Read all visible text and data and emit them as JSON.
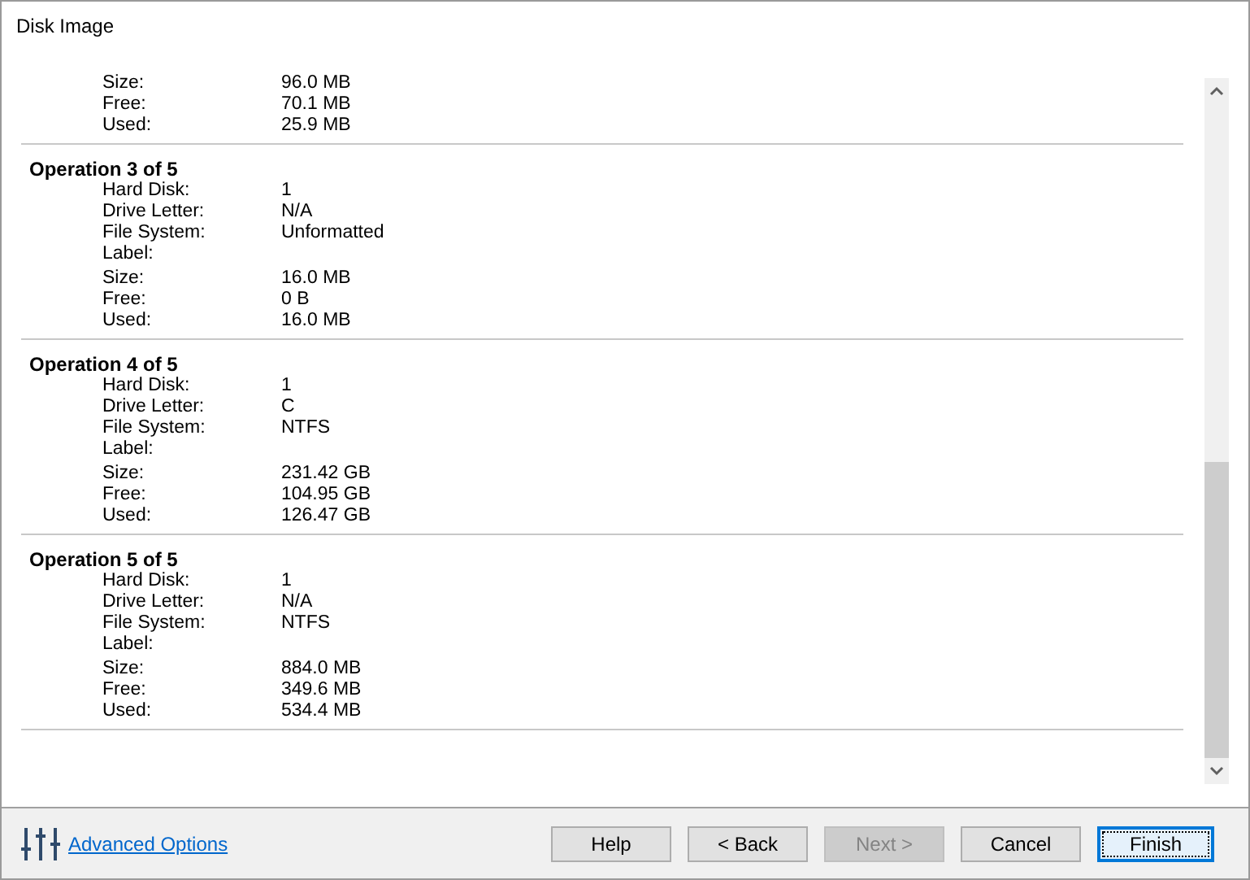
{
  "window": {
    "title": "Disk Image"
  },
  "sections": [
    {
      "groups": [
        [
          {
            "label": "Size:",
            "value": "96.0 MB"
          },
          {
            "label": "Free:",
            "value": "70.1 MB"
          },
          {
            "label": "Used:",
            "value": "25.9 MB"
          }
        ]
      ]
    },
    {
      "heading": "Operation 3 of 5",
      "groups": [
        [
          {
            "label": "Hard Disk:",
            "value": "1"
          },
          {
            "label": "Drive Letter:",
            "value": "N/A"
          },
          {
            "label": "File System:",
            "value": "Unformatted"
          },
          {
            "label": "Label:"
          }
        ],
        [
          {
            "label": "Size:",
            "value": "16.0 MB"
          },
          {
            "label": "Free:",
            "value": "0 B"
          },
          {
            "label": "Used:",
            "value": "16.0 MB"
          }
        ]
      ]
    },
    {
      "heading": "Operation 4 of 5",
      "groups": [
        [
          {
            "label": "Hard Disk:",
            "value": "1"
          },
          {
            "label": "Drive Letter:",
            "value": "C"
          },
          {
            "label": "File System:",
            "value": "NTFS"
          },
          {
            "label": "Label:"
          }
        ],
        [
          {
            "label": "Size:",
            "value": "231.42 GB"
          },
          {
            "label": "Free:",
            "value": "104.95 GB"
          },
          {
            "label": "Used:",
            "value": "126.47 GB"
          }
        ]
      ]
    },
    {
      "heading": "Operation 5 of 5",
      "groups": [
        [
          {
            "label": "Hard Disk:",
            "value": "1"
          },
          {
            "label": "Drive Letter:",
            "value": "N/A"
          },
          {
            "label": "File System:",
            "value": "NTFS"
          },
          {
            "label": "Label:"
          }
        ],
        [
          {
            "label": "Size:",
            "value": "884.0 MB"
          },
          {
            "label": "Free:",
            "value": "349.6 MB"
          },
          {
            "label": "Used:",
            "value": "534.4 MB"
          }
        ]
      ]
    }
  ],
  "advanced_options": "Advanced Options",
  "buttons": [
    {
      "label": "Help",
      "disabled": false,
      "focused": false
    },
    {
      "label": "< Back",
      "disabled": false,
      "focused": false
    },
    {
      "label": "Next >",
      "disabled": true,
      "focused": false
    },
    {
      "label": "Cancel",
      "disabled": false,
      "focused": false
    },
    {
      "label": "Finish",
      "disabled": false,
      "focused": true
    }
  ]
}
